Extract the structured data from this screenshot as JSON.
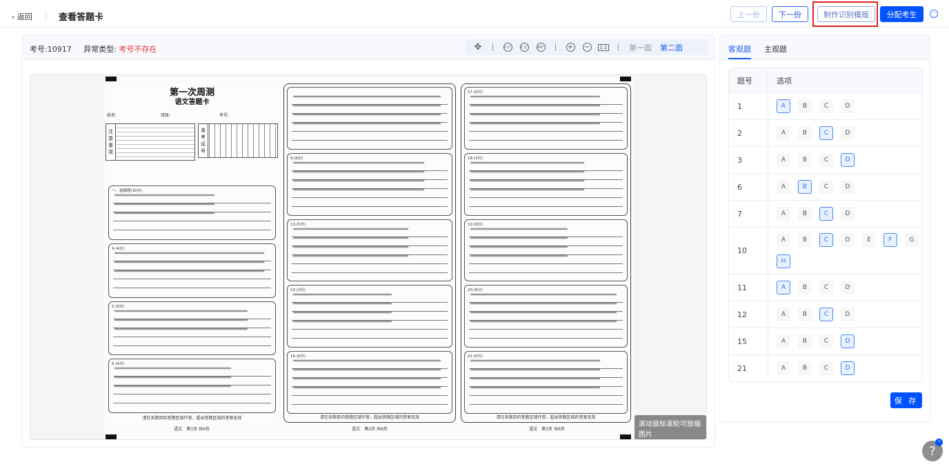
{
  "header": {
    "back": "返回",
    "title": "查看答题卡",
    "prev": "上一份",
    "next": "下一份",
    "make_template": "制作识别模版",
    "assign": "分配考生",
    "more": "···"
  },
  "info": {
    "exam_no_label": "考号:",
    "exam_no": "10917",
    "error_label": "异常类型:",
    "error_value": "考号不存在"
  },
  "toolbar": {
    "rotate1": "0.1°",
    "rotate2": "0.1°",
    "rotate3": "90°",
    "fit": "1:1",
    "face1": "第一面",
    "face2": "第二面"
  },
  "sheet": {
    "title": "第一次周测",
    "subtitle": "语文答题卡",
    "name_label": "姓名:",
    "class_label": "班级:",
    "no_label": "考号:",
    "notice_label": "注意事项",
    "id_label": "准考证号",
    "warning": "请在各题目的答题区域作答，超出答题区域的答案无效",
    "footers": [
      "语文　第1页 共6页",
      "语文　第2页 共6页",
      "语文　第3页 共6页"
    ],
    "pages": [
      [
        {
          "q": "一、选择题(30分)"
        },
        {
          "q": "4.(4分)"
        },
        {
          "q": "5.(6分)"
        },
        {
          "q": "8.(4分)"
        }
      ],
      [
        {
          "q": ""
        },
        {
          "q": "9.(6分)"
        },
        {
          "q": "13.(5分)"
        },
        {
          "q": "14.(3分)"
        },
        {
          "q": "16.(6分)"
        }
      ],
      [
        {
          "q": "17.(6分)"
        },
        {
          "q": "18.(3分)"
        },
        {
          "q": "19.(6分)"
        },
        {
          "q": "20.(6分)"
        },
        {
          "q": "22.(6分)"
        }
      ]
    ]
  },
  "tooltip": "滚动鼠标滚轮可放缩图片",
  "right": {
    "tabs": [
      "客观题",
      "主观题"
    ],
    "col_no": "题号",
    "col_opts": "选项",
    "save": "保 存",
    "rows": [
      {
        "no": "1",
        "opts": [
          "A",
          "B",
          "C",
          "D"
        ],
        "sel": [
          "A"
        ]
      },
      {
        "no": "2",
        "opts": [
          "A",
          "B",
          "C",
          "D"
        ],
        "sel": [
          "C"
        ]
      },
      {
        "no": "3",
        "opts": [
          "A",
          "B",
          "C",
          "D"
        ],
        "sel": [
          "D"
        ]
      },
      {
        "no": "6",
        "opts": [
          "A",
          "B",
          "C",
          "D"
        ],
        "sel": [
          "B"
        ]
      },
      {
        "no": "7",
        "opts": [
          "A",
          "B",
          "C",
          "D"
        ],
        "sel": [
          "C"
        ]
      },
      {
        "no": "10",
        "opts": [
          "A",
          "B",
          "C",
          "D",
          "E",
          "F",
          "G",
          "H"
        ],
        "sel": [
          "C",
          "F",
          "H"
        ]
      },
      {
        "no": "11",
        "opts": [
          "A",
          "B",
          "C",
          "D"
        ],
        "sel": [
          "A"
        ]
      },
      {
        "no": "12",
        "opts": [
          "A",
          "B",
          "C",
          "D"
        ],
        "sel": [
          "C"
        ]
      },
      {
        "no": "15",
        "opts": [
          "A",
          "B",
          "C",
          "D"
        ],
        "sel": [
          "D"
        ]
      },
      {
        "no": "21",
        "opts": [
          "A",
          "B",
          "C",
          "D"
        ],
        "sel": [
          "D"
        ]
      }
    ]
  },
  "help": "?"
}
